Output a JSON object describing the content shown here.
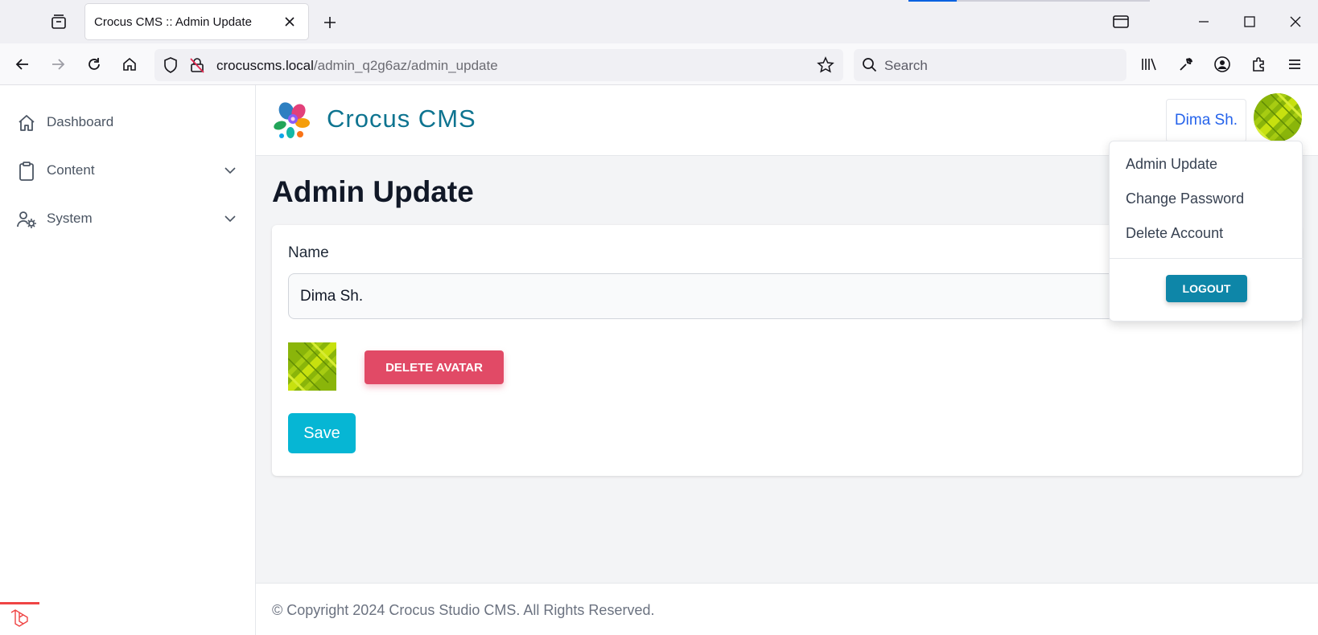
{
  "browser": {
    "tab_title": "Crocus CMS :: Admin Update",
    "url_host": "crocuscms.local",
    "url_path": "/admin_q2g6az/admin_update",
    "search_placeholder": "Search"
  },
  "sidebar": {
    "items": [
      {
        "label": "Dashboard",
        "icon": "home-icon"
      },
      {
        "label": "Content",
        "icon": "clipboard-icon"
      },
      {
        "label": "System",
        "icon": "user-gear-icon"
      }
    ]
  },
  "header": {
    "brand": "Crocus CMS",
    "user_name": "Dima Sh."
  },
  "page": {
    "title": "Admin Update",
    "name_label": "Name",
    "name_value": "Dima Sh.",
    "delete_avatar_label": "DELETE AVATAR",
    "save_label": "Save"
  },
  "dropdown": {
    "items": [
      "Admin Update",
      "Change Password",
      "Delete Account"
    ],
    "logout_label": "LOGOUT"
  },
  "footer": {
    "copyright": "© Copyright 2024 Crocus Studio CMS. All Rights Reserved."
  },
  "colors": {
    "brand": "#0e7490",
    "danger": "#e14a66",
    "primary": "#06b6d4",
    "logout": "#0e86a8",
    "link": "#2563eb"
  }
}
